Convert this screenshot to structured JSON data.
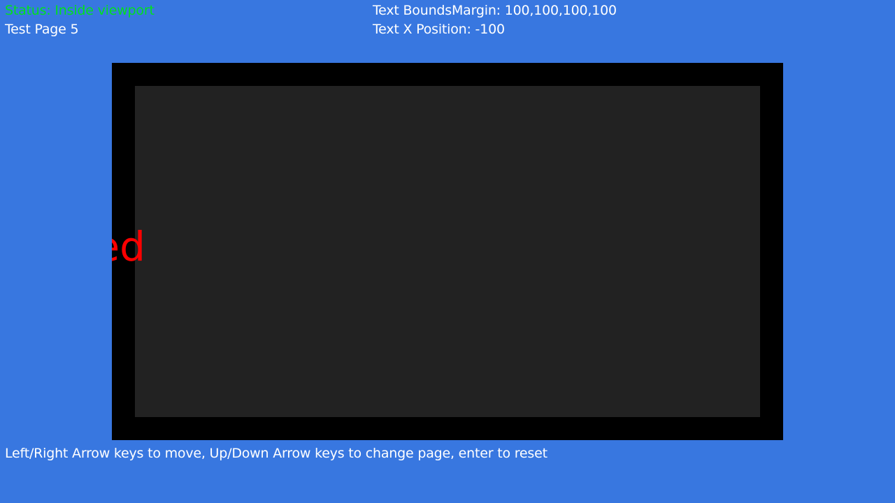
{
  "status": {
    "text": "Status: Inside viewport",
    "color": "#00e020"
  },
  "page": {
    "label": "Test Page 5"
  },
  "info": {
    "bounds_margin": "Text BoundsMargin: 100,100,100,100",
    "text_x_position": "Text X Position: -100"
  },
  "viewport": {
    "moving_text": "Red",
    "text_color": "#ff0000"
  },
  "instructions": {
    "text": "Left/Right Arrow keys to move, Up/Down Arrow keys to change page, enter to reset"
  },
  "colors": {
    "background": "#3877e0",
    "frame": "#000000",
    "inner": "#222222"
  }
}
